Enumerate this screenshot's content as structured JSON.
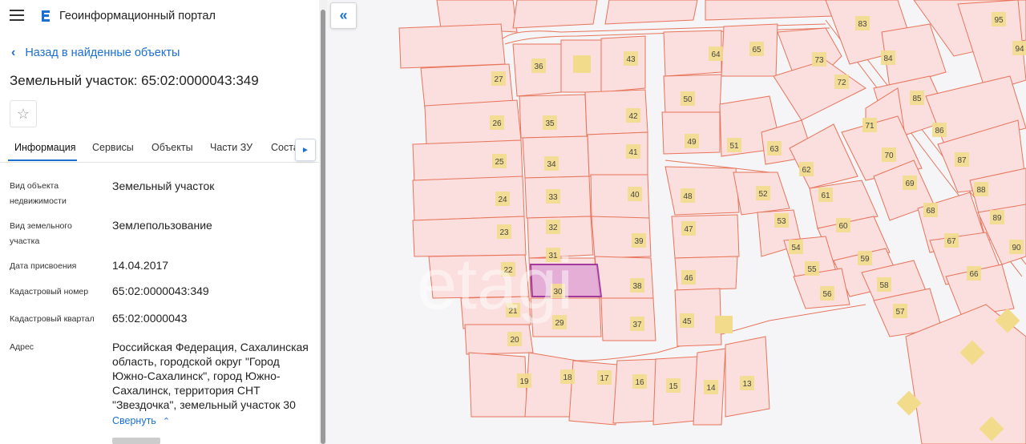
{
  "header": {
    "title": "Геоинформационный портал"
  },
  "back_link": "Назад в найденные объекты",
  "object_title": "Земельный участок: 65:02:0000043:349",
  "tabs": [
    {
      "label": "Информация",
      "active": true
    },
    {
      "label": "Сервисы"
    },
    {
      "label": "Объекты"
    },
    {
      "label": "Части ЗУ"
    },
    {
      "label": "Соста"
    }
  ],
  "info": [
    {
      "label": "Вид объекта недвижимости",
      "value": "Земельный участок"
    },
    {
      "label": "Вид земельного участка",
      "value": "Землепользование"
    },
    {
      "label": "Дата присвоения",
      "value": "14.04.2017"
    },
    {
      "label": "Кадастровый номер",
      "value": "65:02:0000043:349"
    },
    {
      "label": "Кадастровый квартал",
      "value": "65:02:0000043"
    },
    {
      "label": "Адрес",
      "value": "Российская Федерация, Сахалинская область, городской округ \"Город Южно-Сахалинск\", город Южно-Сахалинск, территория СНТ \"Звездочка\", земельный участок 30"
    }
  ],
  "collapse_label": "Свернуть",
  "map": {
    "selected_parcel": "30",
    "colors": {
      "parcel_fill": "#fbdede",
      "parcel_stroke": "#e8745a",
      "label_fill": "#f2dc8c",
      "selected_fill": "#e2a9d6",
      "selected_stroke": "#9b2f9c",
      "accent": "#1a6fd1"
    },
    "parcel_labels": [
      "36",
      "43",
      "27",
      "64",
      "65",
      "83",
      "95",
      "73",
      "84",
      "94",
      "72",
      "26",
      "35",
      "42",
      "50",
      "85",
      "71",
      "86",
      "49",
      "51",
      "63",
      "25",
      "34",
      "41",
      "87",
      "62",
      "70",
      "48",
      "52",
      "24",
      "33",
      "40",
      "61",
      "69",
      "88",
      "53",
      "23",
      "32",
      "39",
      "47",
      "89",
      "60",
      "68",
      "54",
      "67",
      "90",
      "22",
      "31",
      "55",
      "59",
      "46",
      "30",
      "38",
      "56",
      "58",
      "66",
      "21",
      "29",
      "37",
      "45",
      "57",
      "20",
      "19",
      "18",
      "17",
      "16",
      "15",
      "14",
      "13"
    ]
  }
}
